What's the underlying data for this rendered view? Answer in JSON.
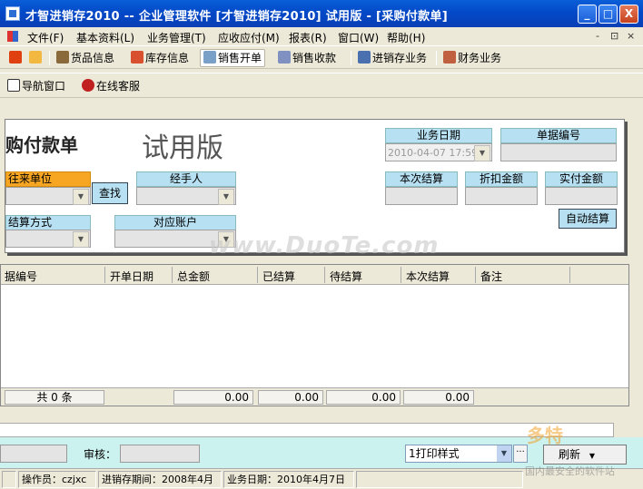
{
  "window": {
    "title": "才智进销存2010 -- 企业管理软件 [才智进销存2010]   试用版 - [采购付款单]",
    "controls": {
      "minimize": "_",
      "maximize": "□",
      "close": "X"
    }
  },
  "menu": {
    "items": [
      "文件(F)",
      "基本资料(L)",
      "业务管理(T)",
      "应收应付(M)",
      "报表(R)",
      "窗口(W)",
      "帮助(H)"
    ],
    "mdi_controls": [
      "-",
      "⊡",
      "×"
    ]
  },
  "toolbar1": {
    "items": [
      {
        "label": "",
        "icon": "exit-icon"
      },
      {
        "label": "",
        "icon": "edit-icon"
      },
      {
        "label": "货品信息",
        "icon": "goods-icon"
      },
      {
        "label": "库存信息",
        "icon": "house-icon"
      },
      {
        "label": "销售开单",
        "icon": "sale-icon"
      },
      {
        "label": "销售收款",
        "icon": "receive-icon"
      },
      {
        "label": "进销存业务",
        "icon": "doc-icon"
      },
      {
        "label": "财务业务",
        "icon": "finance-icon"
      }
    ]
  },
  "toolbar2": {
    "items": [
      {
        "label": "导航窗口",
        "icon": "nav-icon"
      },
      {
        "label": "在线客服",
        "icon": "support-icon"
      }
    ]
  },
  "form": {
    "title": "购付款单",
    "trial_mark": "试用版",
    "fields": {
      "partner_label": "往来单位",
      "handler_label": "经手人",
      "search_button": "查找",
      "settle_method_label": "结算方式",
      "account_label": "对应账户",
      "biz_date_label": "业务日期",
      "biz_date_value": "2010-04-07 17:59",
      "doc_no_label": "单据编号",
      "this_settle_label": "本次结算",
      "discount_label": "折扣金额",
      "paid_label": "实付金额",
      "auto_settle_button": "自动结算"
    }
  },
  "grid": {
    "columns": [
      "据编号",
      "开单日期",
      "总金额",
      "已结算",
      "待结算",
      "本次结算",
      "备注"
    ],
    "rows": [],
    "footer": {
      "count": "共 0 条",
      "totals": [
        "0.00",
        "0.00",
        "0.00",
        "0.00"
      ]
    }
  },
  "bottom": {
    "review_label": "审核：",
    "print_style": "1打印样式",
    "more_button": "···",
    "refresh_button": "刷新"
  },
  "status": {
    "operator": "操作员：czjxc",
    "period": "进销存期间：2008年4月",
    "biz_date": "业务日期：2010年4月7日"
  },
  "watermarks": {
    "site": "www.DuoTe.com",
    "logo_text": "多特",
    "logo_sub": "国内最安全的软件站"
  },
  "colors": {
    "titlebar": "#0349c8",
    "header_blue": "#b7e0f2",
    "header_orange": "#f7a623",
    "bottom_panel": "#ccf2ef"
  }
}
